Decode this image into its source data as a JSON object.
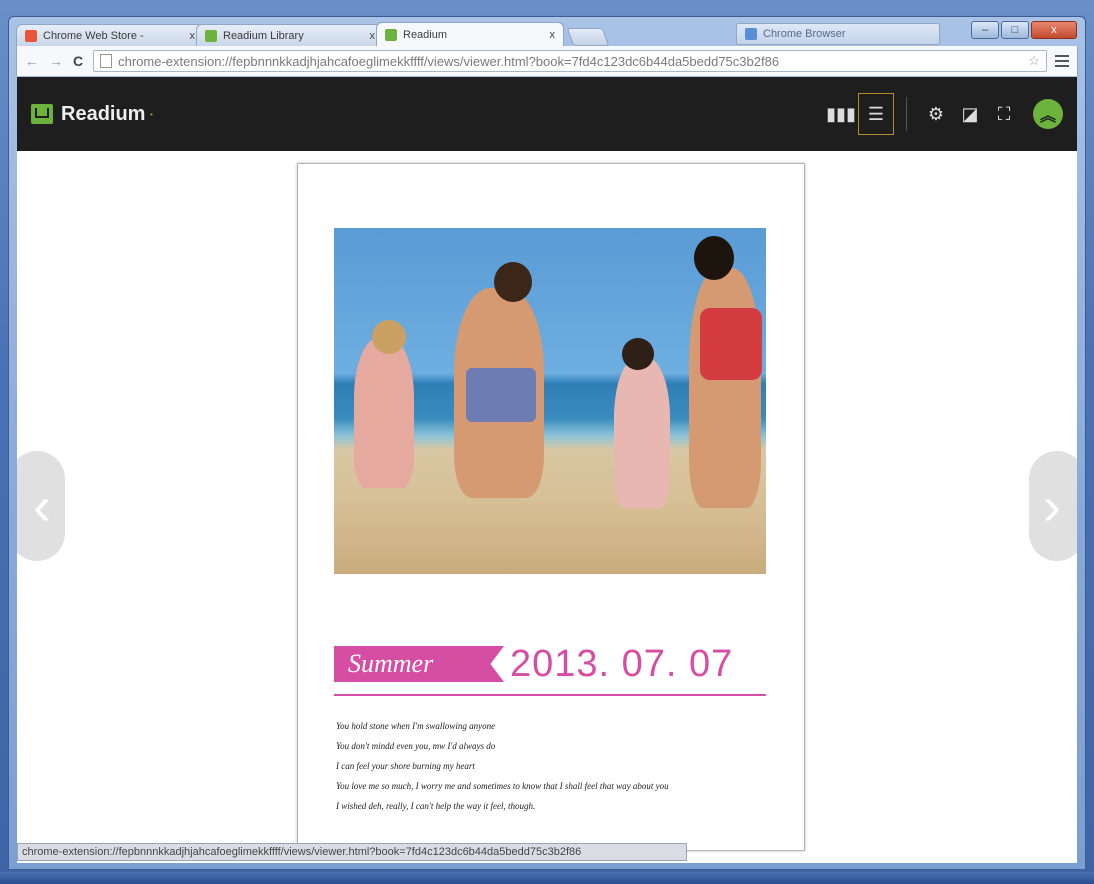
{
  "window": {
    "controls": {
      "minimize": "–",
      "maximize": "□",
      "close": "x"
    }
  },
  "tabs": [
    {
      "title": "Chrome Web Store -",
      "close": "x",
      "fav_color": "#e8553a"
    },
    {
      "title": "Readium Library",
      "close": "x",
      "fav_color": "#6cb33e"
    },
    {
      "title": "Readium",
      "close": "x",
      "fav_color": "#6cb33e",
      "active": true
    }
  ],
  "extra_box": {
    "label": "Chrome Browser"
  },
  "address_bar": {
    "url": "chrome-extension://fepbnnnkkadjhjahcafoeglimekkffff/views/viewer.html?book=7fd4c123dc6b44da5bedd75c3b2f86",
    "back": "←",
    "forward": "→",
    "reload": "C",
    "star": "☆"
  },
  "readium": {
    "brand": "Readium",
    "dot": "·",
    "icons": {
      "library": "▮▮▮",
      "toc": "☰",
      "settings": "⚙",
      "contrast": "◪",
      "fullscreen": "⛶",
      "up": "︽"
    }
  },
  "page": {
    "summer_label": "Summer",
    "date": "2013. 07. 07",
    "poem_lines": [
      "You hold stone when I'm swallowing anyone",
      "You don't mindd even you, mw I'd always do",
      "I can feel your shore burning my heart",
      "You love me so much, I worry me and sometimes to know that I shall feel that way about you",
      "I wished deh, really, I can't help the way it feel, though."
    ]
  },
  "pager": {
    "prev": "‹",
    "next": "›"
  },
  "status_url": "chrome-extension://fepbnnnkkadjhjahcafoeglimekkffff/views/viewer.html?book=7fd4c123dc6b44da5bedd75c3b2f86"
}
